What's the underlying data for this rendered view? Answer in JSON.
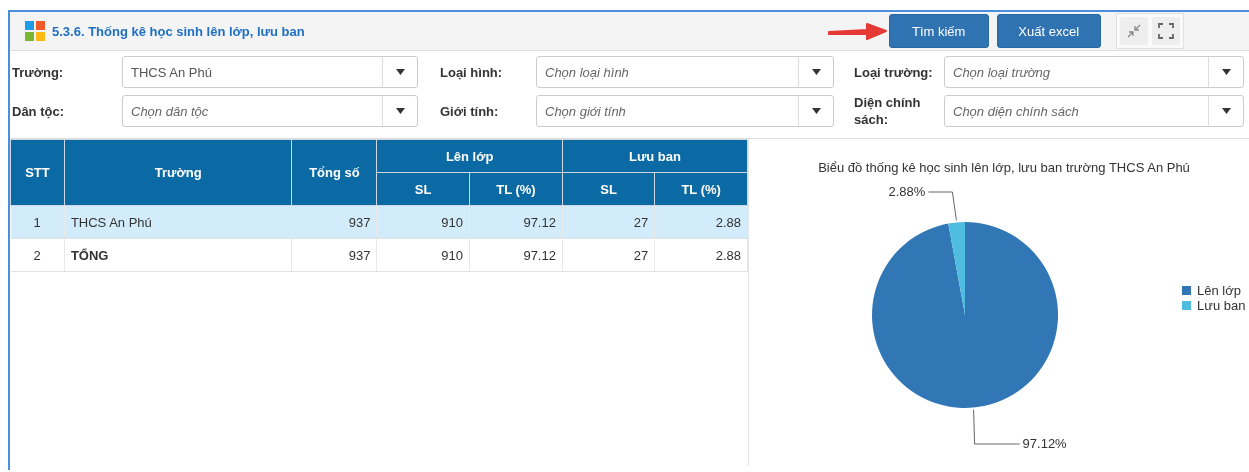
{
  "header": {
    "title": "5.3.6. Thống kê học sinh lên lớp, lưu ban",
    "buttons": [
      "Tìm kiếm",
      "Xuất excel"
    ]
  },
  "filters": [
    {
      "label": "Trường:",
      "value": "THCS An Phú"
    },
    {
      "label": "Loại hình:",
      "placeholder": "Chọn loại hình"
    },
    {
      "label": "Loại trường:",
      "placeholder": "Chọn loại trường"
    },
    {
      "label": "Dân tộc:",
      "placeholder": "Chọn dân tộc"
    },
    {
      "label": "Giới tính:",
      "placeholder": "Chọn giới tính"
    },
    {
      "label": "Diện chính sách:",
      "placeholder": "Chọn diện chính sách"
    }
  ],
  "table": {
    "columns": {
      "stt": "STT",
      "school": "Trường",
      "total": "Tổng số",
      "groups": [
        {
          "label": "Lên lớp",
          "sub": [
            "SL",
            "TL (%)"
          ]
        },
        {
          "label": "Lưu ban",
          "sub": [
            "SL",
            "TL (%)"
          ]
        }
      ]
    },
    "rows": [
      {
        "stt": "1",
        "school": "THCS An Phú",
        "total": "937",
        "values": [
          "910",
          "97.12",
          "27",
          "2.88"
        ],
        "selected": true,
        "kind": "school"
      },
      {
        "stt": "2",
        "school": "TỔNG",
        "total": "937",
        "values": [
          "910",
          "97.12",
          "27",
          "2.88"
        ],
        "selected": false,
        "kind": "total"
      }
    ]
  },
  "chart": {
    "chart_data": {
      "type": "pie",
      "title": "Biểu đồ thống kê học sinh lên lớp, lưu ban trường THCS An Phú",
      "categories": [
        "Lên lớp",
        "Lưu ban"
      ],
      "values": [
        97.12,
        2.88
      ],
      "legend": "right",
      "colors": [
        "#3277b5",
        "#4fbde0"
      ],
      "value_labels": [
        "97.12%",
        "2.88%"
      ]
    }
  }
}
